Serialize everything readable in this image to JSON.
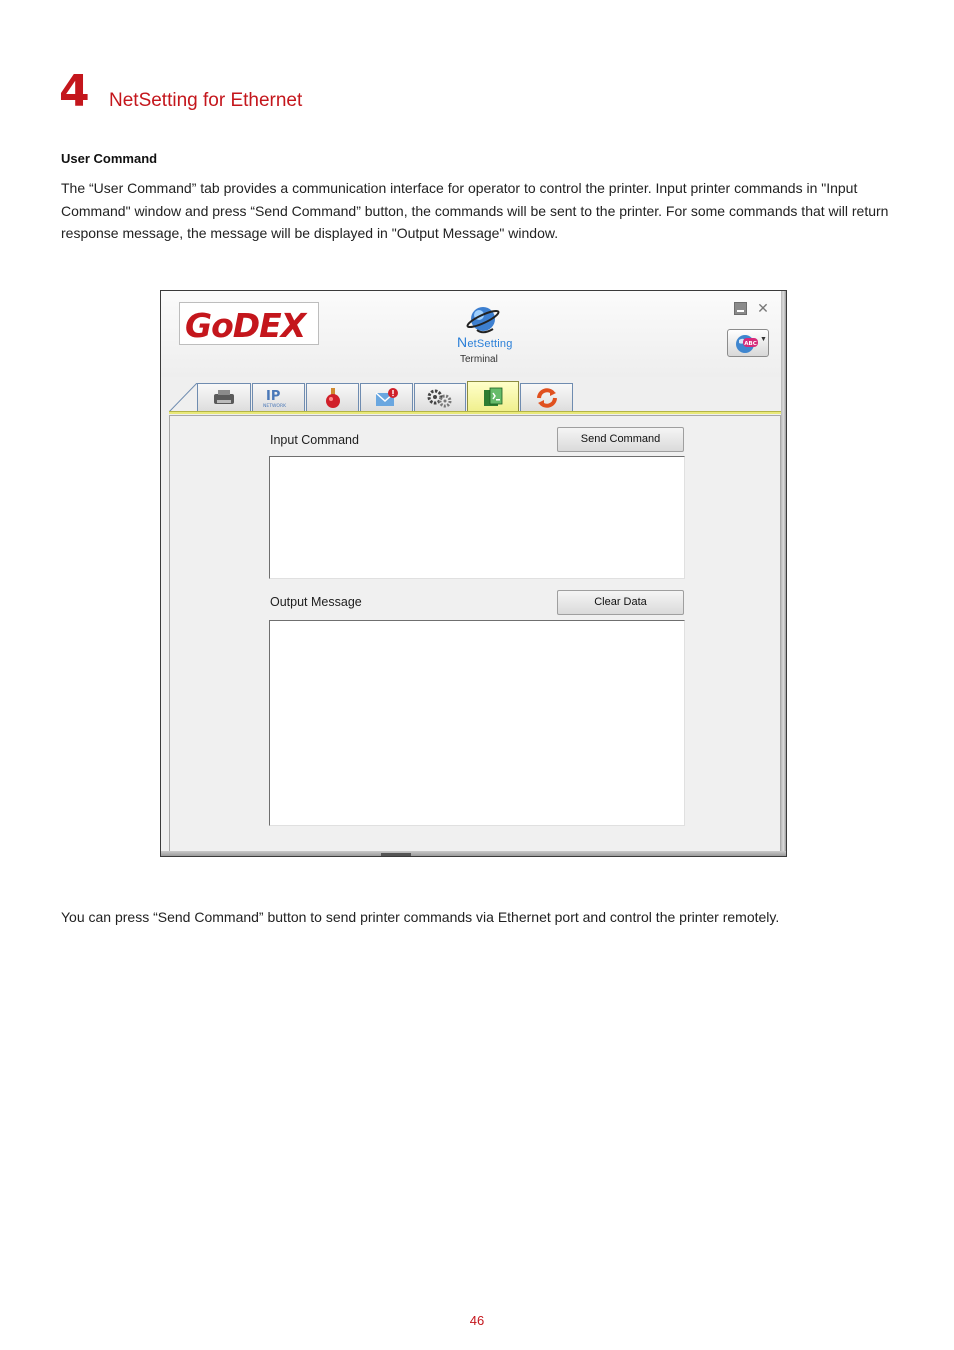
{
  "chapter": {
    "number": "4",
    "title": "NetSetting for Ethernet"
  },
  "section": {
    "heading": "User Command",
    "intro": "The “User Command” tab provides a communication interface for operator to control the printer. Input printer commands in \"Input Command\" window and press “Send Command” button, the commands will be sent to the printer. For some commands that will return response message, the message will be displayed in \"Output Message\" window.",
    "note": "You can press “Send Command” button to send printer commands via Ethernet port and control the printer remotely."
  },
  "app": {
    "logo_text": "GoDEX",
    "netsetting_first": "N",
    "netsetting_rest": "etSetting",
    "mode_label": "Terminal",
    "lang_badge": "ABC",
    "tabs": [
      {
        "icon": "printer-icon",
        "active": false
      },
      {
        "icon": "network-ip-icon",
        "active": false
      },
      {
        "icon": "hand-bell-icon",
        "active": false
      },
      {
        "icon": "mail-alert-icon",
        "active": false
      },
      {
        "icon": "gears-icon",
        "active": false
      },
      {
        "icon": "terminal-icon",
        "active": true
      },
      {
        "icon": "refresh-icon",
        "active": false
      }
    ],
    "ip_tab_text": "IP",
    "ip_tab_sub": "NETWORK",
    "input_label": "Input Command",
    "send_button": "Send Command",
    "output_label": "Output Message",
    "clear_button": "Clear Data",
    "input_value": "",
    "output_value": ""
  },
  "colors": {
    "accent": "#c4161c",
    "active_tab": "#efef8a",
    "link_blue": "#2a7fd8"
  },
  "page_number": "46"
}
